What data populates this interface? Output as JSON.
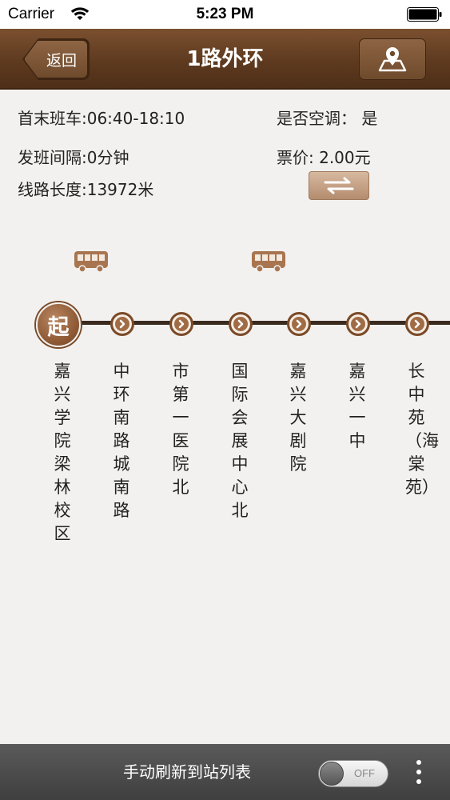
{
  "status_bar": {
    "carrier": "Carrier",
    "time": "5:23 PM"
  },
  "nav": {
    "back_label": "返回",
    "title": "1路外环",
    "map_icon": "map-pin-icon"
  },
  "info": {
    "first_last_bus": "首末班车:06:40-18:10",
    "air_conditioning": "是否空调：  是",
    "interval": "发班间隔:0分钟",
    "fare": "票价: 2.00元",
    "length": "线路长度:13972米"
  },
  "route": {
    "start_label": "起",
    "stops": [
      {
        "name": "嘉兴学院梁林校区"
      },
      {
        "name": "中环南路城南路"
      },
      {
        "name": "市第一医院北"
      },
      {
        "name": "国际会展中心北"
      },
      {
        "name": "嘉兴大剧院"
      },
      {
        "name": "嘉兴一中"
      },
      {
        "name": "长中苑（海棠苑）"
      }
    ]
  },
  "bottom_bar": {
    "label": "手动刷新到站列表",
    "toggle_state": "OFF"
  },
  "colors": {
    "nav_brown": "#5e3a1f",
    "accent_brown": "#8a5632",
    "background": "#f2f1ef"
  }
}
